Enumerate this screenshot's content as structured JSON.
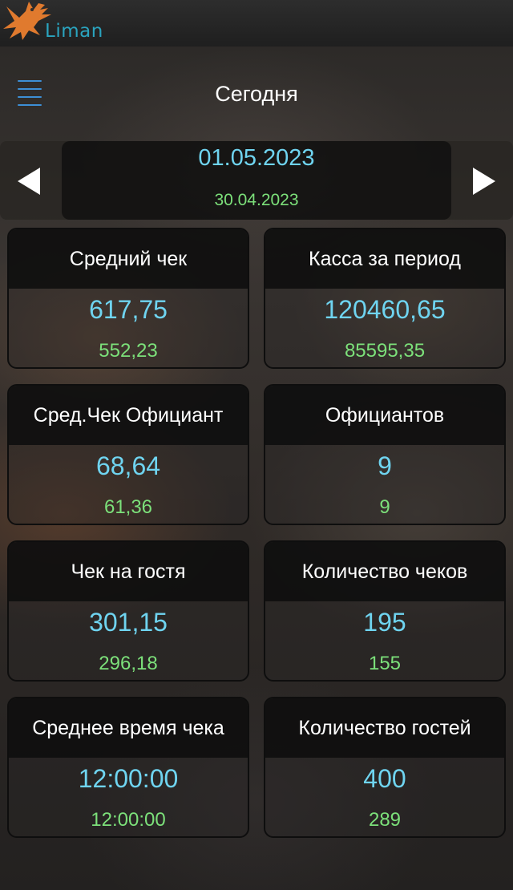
{
  "app": {
    "logo_text": "Liman"
  },
  "header": {
    "title": "Сегодня"
  },
  "date_bar": {
    "current_date": "01.05.2023",
    "previous_date": "30.04.2023"
  },
  "cards": [
    {
      "title": "Средний чек",
      "value": "617,75",
      "previous": "552,23"
    },
    {
      "title": "Касса за период",
      "value": "120460,65",
      "previous": "85595,35"
    },
    {
      "title": "Сред.Чек Официант",
      "value": "68,64",
      "previous": "61,36"
    },
    {
      "title": "Официантов",
      "value": "9",
      "previous": "9"
    },
    {
      "title": "Чек на гостя",
      "value": "301,15",
      "previous": "296,18"
    },
    {
      "title": "Количество чеков",
      "value": "195",
      "previous": "155"
    },
    {
      "title": "Среднее время чека",
      "value": "12:00:00",
      "previous": "12:00:00"
    },
    {
      "title": "Количество гостей",
      "value": "400",
      "previous": "289"
    }
  ],
  "colors": {
    "value": "#6fd4f0",
    "previous": "#7ce07a",
    "logo": "#2aa4bf",
    "logo_bird": "#e07a2e",
    "menu_icon": "#3d8fd6"
  },
  "icons": [
    "eagle-logo-icon",
    "hamburger-menu-icon",
    "arrow-left-icon",
    "arrow-right-icon"
  ]
}
